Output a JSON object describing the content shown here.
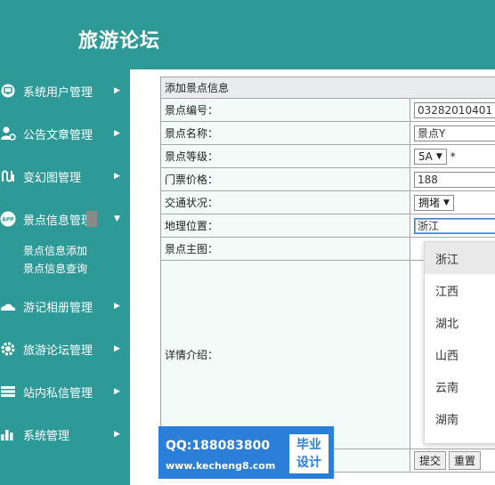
{
  "app": {
    "title": "旅游论坛"
  },
  "sidebar": {
    "items": [
      {
        "label": "系统用户管理",
        "icon": "monitor-icon"
      },
      {
        "label": "公告文章管理",
        "icon": "user-settings-icon"
      },
      {
        "label": "变幻图管理",
        "icon": "chain-icon"
      },
      {
        "label": "景点信息管理",
        "icon": "app-icon"
      },
      {
        "label": "游记相册管理",
        "icon": "cloud-icon"
      },
      {
        "label": "旅游论坛管理",
        "icon": "gear-icon"
      },
      {
        "label": "站内私信管理",
        "icon": "stack-icon"
      },
      {
        "label": "系统管理",
        "icon": "bar-chart-icon"
      }
    ],
    "subitems": [
      {
        "label": "景点信息添加"
      },
      {
        "label": "景点信息查询"
      }
    ]
  },
  "form": {
    "header": "添加景点信息",
    "fields": {
      "code": {
        "label": "景点编号：",
        "value": "03282010401"
      },
      "name": {
        "label": "景点名称：",
        "value": "景点Y"
      },
      "level": {
        "label": "景点等级：",
        "value": "5A",
        "required_mark": "*"
      },
      "price": {
        "label": "门票价格：",
        "value": "188"
      },
      "traffic": {
        "label": "交通状况：",
        "value": "拥堵"
      },
      "location": {
        "label": "地理位置：",
        "value": "浙江"
      },
      "image": {
        "label": "景点主图："
      },
      "detail": {
        "label": "详情介绍："
      }
    },
    "submit_label": "提交",
    "reset_label": "重置"
  },
  "location_dropdown": {
    "options": [
      "浙江",
      "江西",
      "湖北",
      "山西",
      "云南",
      "湖南"
    ],
    "active": "浙江"
  },
  "watermark": {
    "qq": "QQ:188083800",
    "url": "www.kecheng8.com",
    "badge_line1": "毕业",
    "badge_line2": "设计"
  },
  "colors": {
    "teal": "#2e9a98",
    "watermark_blue": "#2b7fd8",
    "label_bg": "#f3fbf9"
  }
}
